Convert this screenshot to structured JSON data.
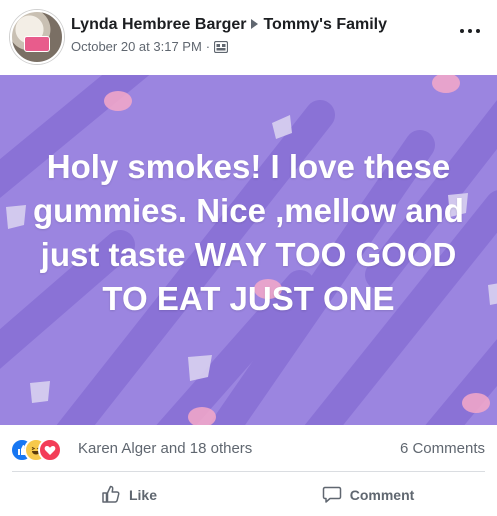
{
  "post": {
    "author": "Lynda Hembree Barger",
    "group": "Tommy's Family",
    "timestamp": "October 20 at 3:17 PM",
    "separator": "·",
    "privacy_icon": "group-icon",
    "more_icon": "more-options-icon",
    "text": "Holy smokes! I love these gummies. Nice ,mellow and just taste WAY TOO GOOD TO EAT JUST ONE",
    "background_color": "#9b85e0"
  },
  "reactions": {
    "icons": [
      "like-reaction-icon",
      "haha-reaction-icon",
      "love-reaction-icon"
    ],
    "names": "Karen Alger and 18 others",
    "comments": "6 Comments"
  },
  "actions": {
    "like_label": "Like",
    "comment_label": "Comment"
  },
  "colors": {
    "like_blue": "#1877f2",
    "love_red": "#f33e58",
    "haha_yellow": "#f7c94b",
    "text_secondary": "#606770"
  }
}
